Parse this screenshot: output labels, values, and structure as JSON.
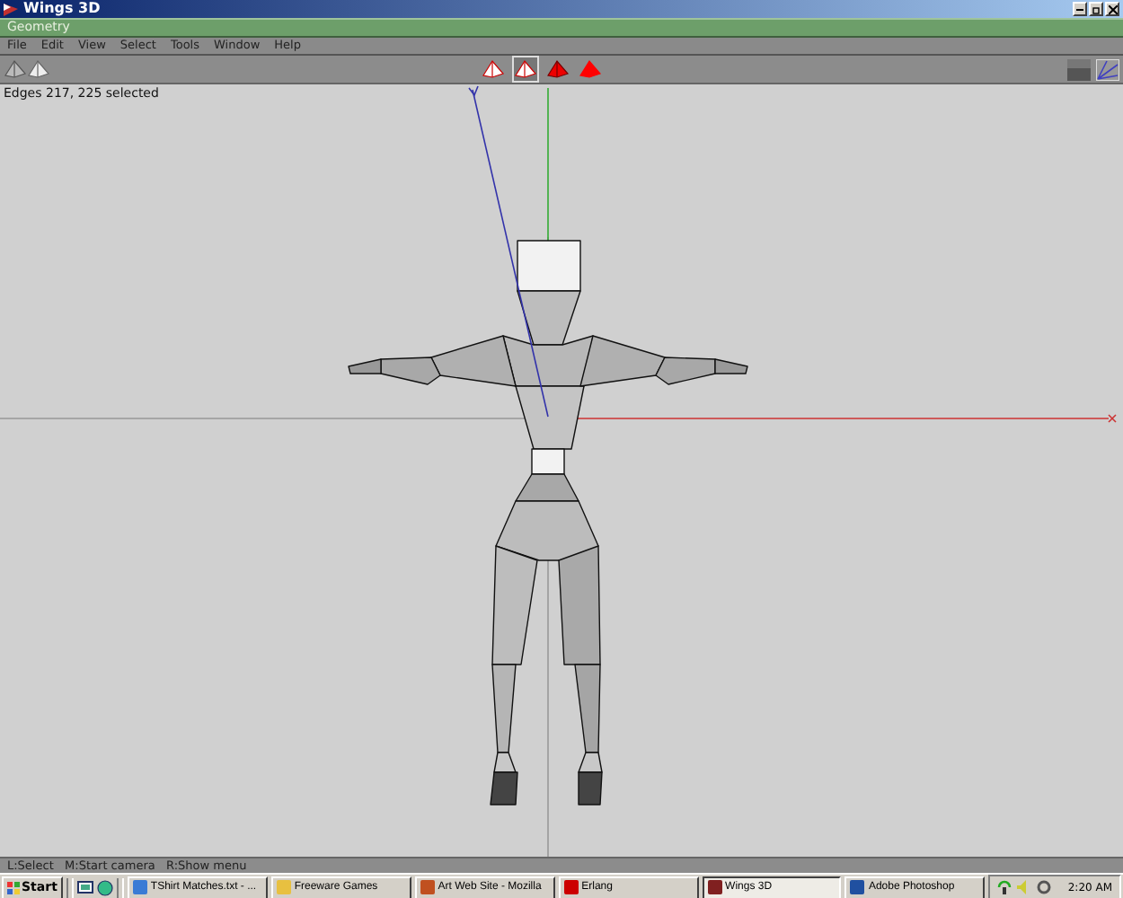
{
  "window": {
    "title": "Wings 3D"
  },
  "panel": {
    "title": "Geometry"
  },
  "menu": [
    "File",
    "Edit",
    "View",
    "Select",
    "Tools",
    "Window",
    "Help"
  ],
  "select_modes": [
    {
      "kind": "vertex",
      "selected": false
    },
    {
      "kind": "edge",
      "selected": true
    },
    {
      "kind": "face",
      "selected": false
    },
    {
      "kind": "body",
      "selected": false
    }
  ],
  "viewport": {
    "info": "Edges 217, 225 selected"
  },
  "status_bar": "L:Select   M:Start camera   R:Show menu",
  "taskbar": {
    "start": "Start",
    "tasks": [
      {
        "label": "TShirt Matches.txt - ...",
        "kind": "notepad",
        "selected": false
      },
      {
        "label": "Freeware Games",
        "kind": "folder",
        "selected": false
      },
      {
        "label": "Art Web Site - Mozilla",
        "kind": "browser",
        "selected": false
      },
      {
        "label": "Erlang",
        "kind": "erlang",
        "selected": false
      },
      {
        "label": "Wings 3D",
        "kind": "wings",
        "selected": true
      },
      {
        "label": "Adobe Photoshop",
        "kind": "photoshop",
        "selected": false
      }
    ],
    "clock": "2:20 AM"
  }
}
